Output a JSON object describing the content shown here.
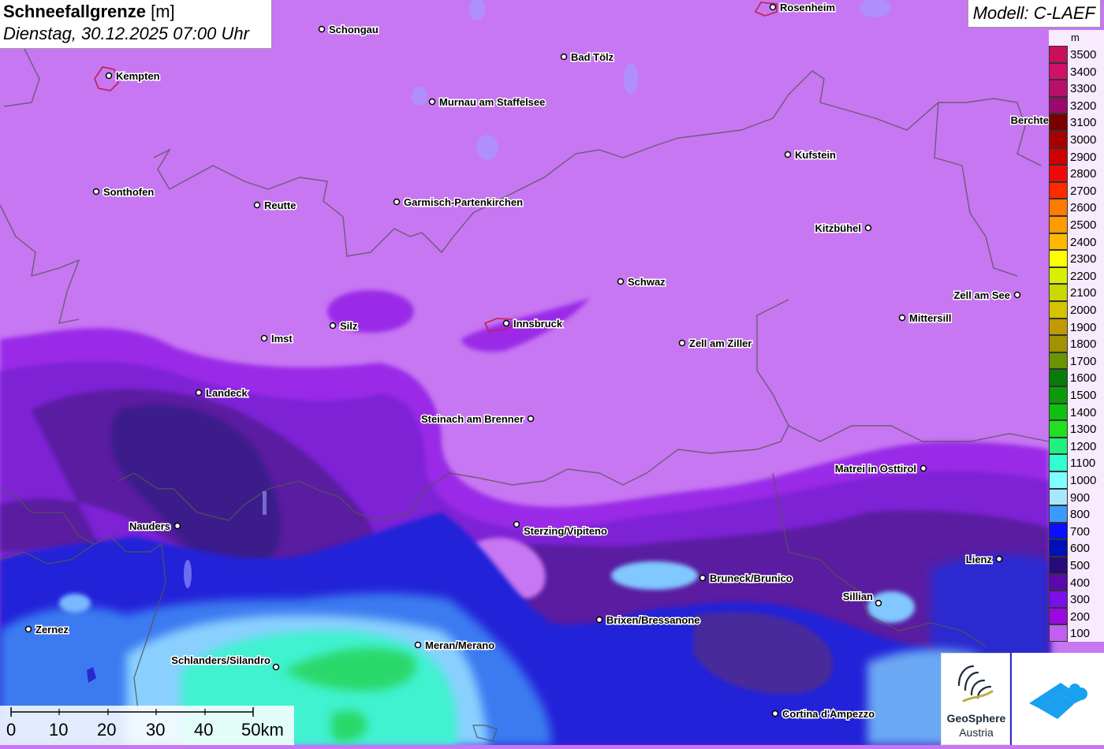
{
  "title": {
    "main": "Schneefallgrenze",
    "unit": "[m]",
    "subtitle": "Dienstag, 30.12.2025 07:00 Uhr"
  },
  "model": "Modell: C-LAEF",
  "legend": {
    "unit": "m",
    "entries": [
      {
        "value": "3500",
        "color": "#c8105a"
      },
      {
        "value": "3400",
        "color": "#d0106a"
      },
      {
        "value": "3300",
        "color": "#b8106a"
      },
      {
        "value": "3200",
        "color": "#9a0a6a"
      },
      {
        "value": "3100",
        "color": "#7a0000"
      },
      {
        "value": "3000",
        "color": "#a80000"
      },
      {
        "value": "2900",
        "color": "#d00000"
      },
      {
        "value": "2800",
        "color": "#ee0a0a"
      },
      {
        "value": "2700",
        "color": "#ff2a00"
      },
      {
        "value": "2600",
        "color": "#ff7a00"
      },
      {
        "value": "2500",
        "color": "#ff9a00"
      },
      {
        "value": "2400",
        "color": "#ffb800"
      },
      {
        "value": "2300",
        "color": "#ffff00"
      },
      {
        "value": "2200",
        "color": "#d8f000"
      },
      {
        "value": "2100",
        "color": "#c8d800"
      },
      {
        "value": "2000",
        "color": "#d4c400"
      },
      {
        "value": "1900",
        "color": "#c09a00"
      },
      {
        "value": "1800",
        "color": "#a09200"
      },
      {
        "value": "1700",
        "color": "#6a9400"
      },
      {
        "value": "1600",
        "color": "#0a7a0a"
      },
      {
        "value": "1500",
        "color": "#0a9a0a"
      },
      {
        "value": "1400",
        "color": "#10c010"
      },
      {
        "value": "1300",
        "color": "#20e020"
      },
      {
        "value": "1200",
        "color": "#20f080"
      },
      {
        "value": "1100",
        "color": "#30ffd0"
      },
      {
        "value": "1000",
        "color": "#80ffff"
      },
      {
        "value": "900",
        "color": "#a8e8ff"
      },
      {
        "value": "800",
        "color": "#3a9aff"
      },
      {
        "value": "700",
        "color": "#0a10ff"
      },
      {
        "value": "600",
        "color": "#0010b8"
      },
      {
        "value": "500",
        "color": "#280a7a"
      },
      {
        "value": "400",
        "color": "#5a0aaa"
      },
      {
        "value": "300",
        "color": "#7a10e8"
      },
      {
        "value": "200",
        "color": "#9a0ae0"
      },
      {
        "value": "100",
        "color": "#c060f0"
      }
    ]
  },
  "scale_bar": {
    "labels": [
      "0",
      "10",
      "20",
      "30",
      "40",
      "50km"
    ]
  },
  "cities": [
    {
      "name": "Rosenheim"
    },
    {
      "name": "Schongau"
    },
    {
      "name": "Kempten"
    },
    {
      "name": "Bad Tölz"
    },
    {
      "name": "Murnau am Staffelsee"
    },
    {
      "name": "Berchte"
    },
    {
      "name": "Kufstein"
    },
    {
      "name": "Sonthofen"
    },
    {
      "name": "Reutte"
    },
    {
      "name": "Garmisch-Partenkirchen"
    },
    {
      "name": "Kitzbühel"
    },
    {
      "name": "Schwaz"
    },
    {
      "name": "Zell am See"
    },
    {
      "name": "Silz"
    },
    {
      "name": "Innsbruck"
    },
    {
      "name": "Mittersill"
    },
    {
      "name": "Imst"
    },
    {
      "name": "Zell am Ziller"
    },
    {
      "name": "Landeck"
    },
    {
      "name": "Steinach am Brenner"
    },
    {
      "name": "Matrei in Osttirol"
    },
    {
      "name": "Nauders"
    },
    {
      "name": "Sterzing/Vipiteno"
    },
    {
      "name": "Lienz"
    },
    {
      "name": "Bruneck/Brunico"
    },
    {
      "name": "Sillian"
    },
    {
      "name": "Brixen/Bressanone"
    },
    {
      "name": "Zernez"
    },
    {
      "name": "Meran/Merano"
    },
    {
      "name": "Schlanders/Silandro"
    },
    {
      "name": "Cortina d'Ampezzo"
    }
  ],
  "logos": {
    "geosphere_name": "GeoSphere",
    "geosphere_sub": "Austria"
  },
  "colors": {
    "base_field": "#c777f2",
    "border_lines": "#555555"
  }
}
